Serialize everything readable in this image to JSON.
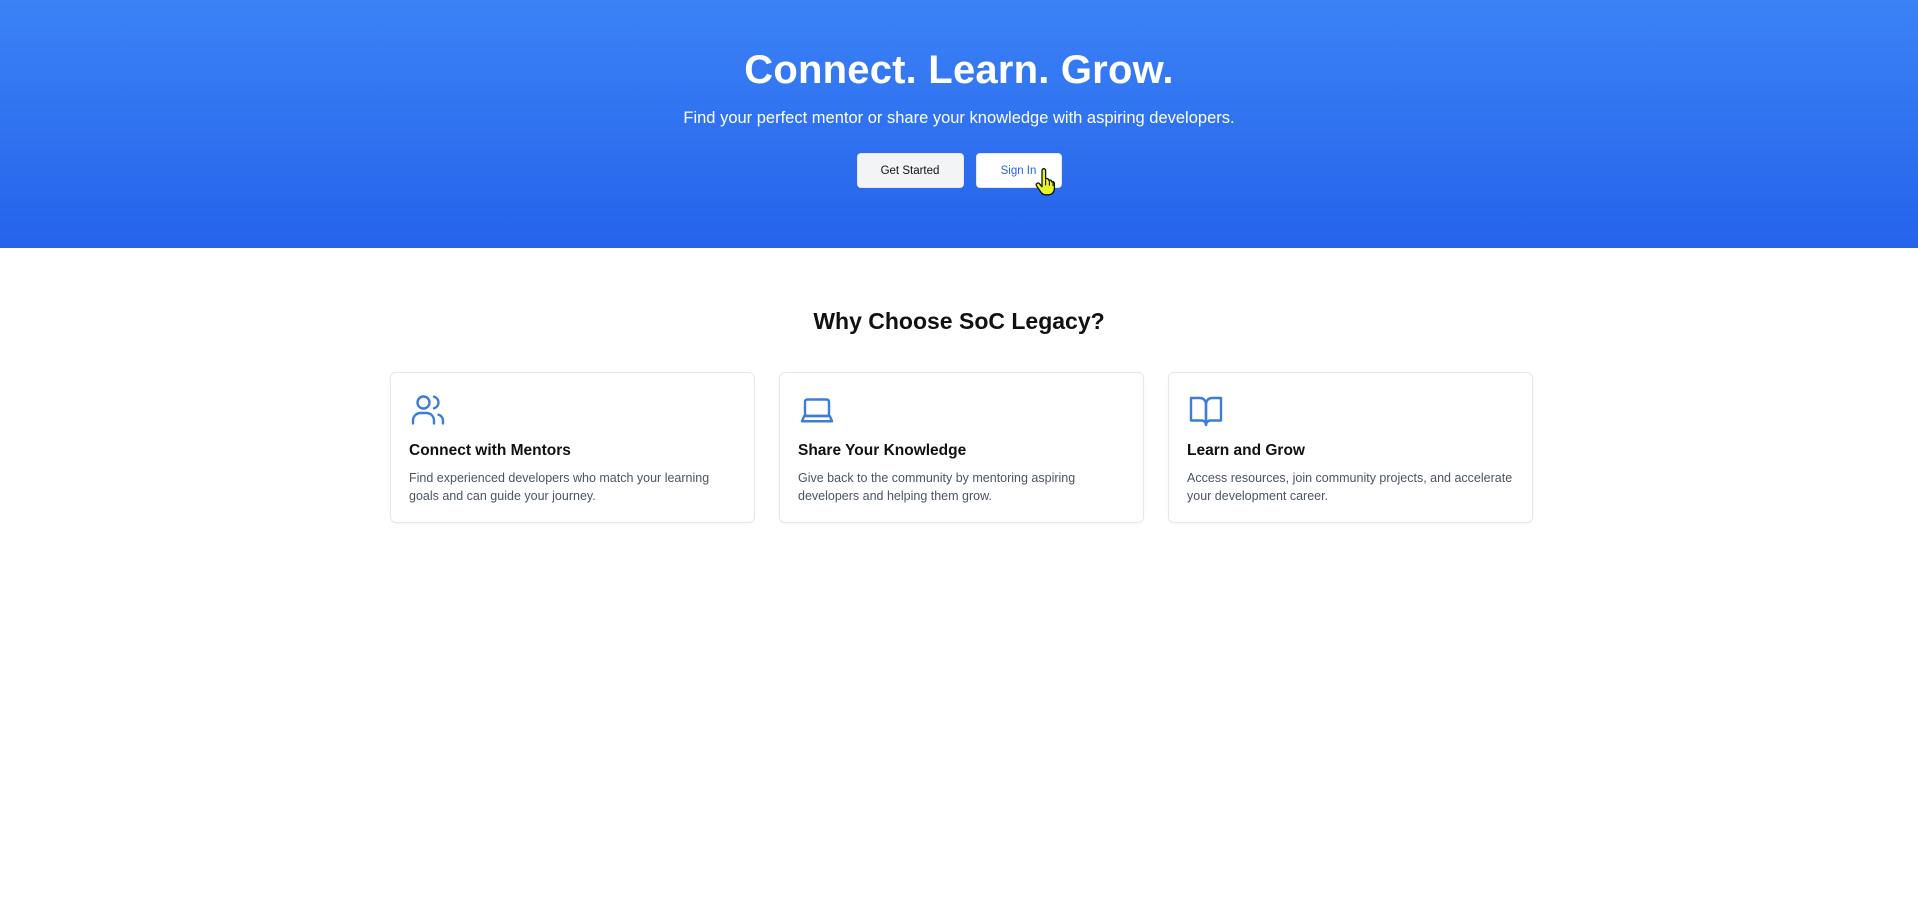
{
  "hero": {
    "title": "Connect. Learn. Grow.",
    "subtitle": "Find your perfect mentor or share your knowledge with aspiring developers.",
    "get_started_label": "Get Started",
    "sign_in_label": "Sign In"
  },
  "features": {
    "heading": "Why Choose SoC Legacy?",
    "cards": [
      {
        "icon": "users-icon",
        "title": "Connect with Mentors",
        "description": "Find experienced developers who match your learning goals and can guide your journey."
      },
      {
        "icon": "laptop-icon",
        "title": "Share Your Knowledge",
        "description": "Give back to the community by mentoring aspiring developers and helping them grow."
      },
      {
        "icon": "book-open-icon",
        "title": "Learn and Grow",
        "description": "Access resources, join community projects, and accelerate your development career."
      }
    ]
  },
  "colors": {
    "hero_gradient_top": "#3b82f6",
    "hero_gradient_bottom": "#2563eb",
    "accent": "#2563eb",
    "icon": "#3b7dd8",
    "card_border": "#e5e7eb",
    "muted_text": "#4b5563"
  }
}
